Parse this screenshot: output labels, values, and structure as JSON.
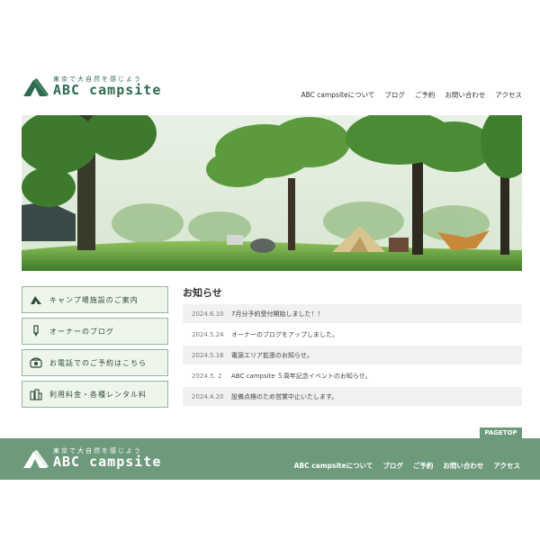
{
  "header": {
    "logo_tagline": "東京で大自然を感じよう",
    "logo_name": "ABC campsite",
    "nav": [
      "ABC campsiteについて",
      "ブログ",
      "ご予約",
      "お問い合わせ",
      "アクセス"
    ]
  },
  "hero": {
    "alt": "campsite-photo"
  },
  "side_menu": [
    {
      "label": "キャンプ場施設のご案内",
      "icon": "tent-icon"
    },
    {
      "label": "オーナーのブログ",
      "icon": "pen-icon"
    },
    {
      "label": "お電話でのご予約はこちら",
      "icon": "phone-icon"
    },
    {
      "label": "利用料金・各種レンタル料",
      "icon": "price-icon"
    }
  ],
  "news": {
    "title": "お知らせ",
    "items": [
      {
        "date": "2024.6.10",
        "text": "7月分予約受付開始しました！！"
      },
      {
        "date": "2024.5.24",
        "text": "オーナーのブログをアップしました。"
      },
      {
        "date": "2024.5.16",
        "text": "電源エリア拡張のお知らせ。"
      },
      {
        "date": "2024.5. 2",
        "text": "ABC campsite ５周年記念イベントのお知らせ。"
      },
      {
        "date": "2024.4.20",
        "text": "設備点検のため営業中止いたします。"
      }
    ]
  },
  "footer": {
    "pagetop": "PAGETOP",
    "logo_tagline": "東京で大自然を感じよう",
    "logo_name": "ABC campsite",
    "nav": [
      "ABC campsiteについて",
      "ブログ",
      "ご予約",
      "お問い合わせ",
      "アクセス"
    ]
  },
  "colors": {
    "brand": "#2f6a4f",
    "footer": "#6c9a7b",
    "menu_bg": "#eef6ec",
    "menu_border": "#8fb99a"
  }
}
